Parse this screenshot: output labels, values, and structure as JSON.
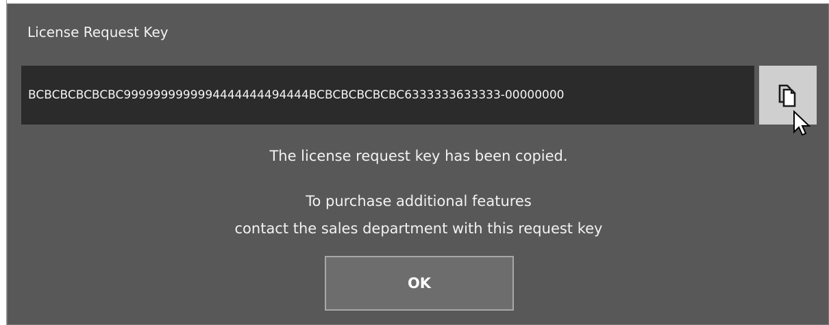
{
  "dialog": {
    "title": "License Request Key",
    "request_key": "BCBCBCBCBCBC9999999999994444444494444BCBCBCBCBCBC6333333633333-00000000",
    "copy_button_icon": "copy-icon",
    "message_copied": "The license request key has been copied.",
    "message_line1": "To purchase additional features",
    "message_line2": "contact the sales department with this request key",
    "ok_label": "OK"
  },
  "colors": {
    "dialog_background": "#585858",
    "key_box_background": "#2b2b2b",
    "copy_button_background": "#cfcfcf",
    "ok_button_background": "#6d6d6d",
    "text": "#f2f2f2"
  }
}
